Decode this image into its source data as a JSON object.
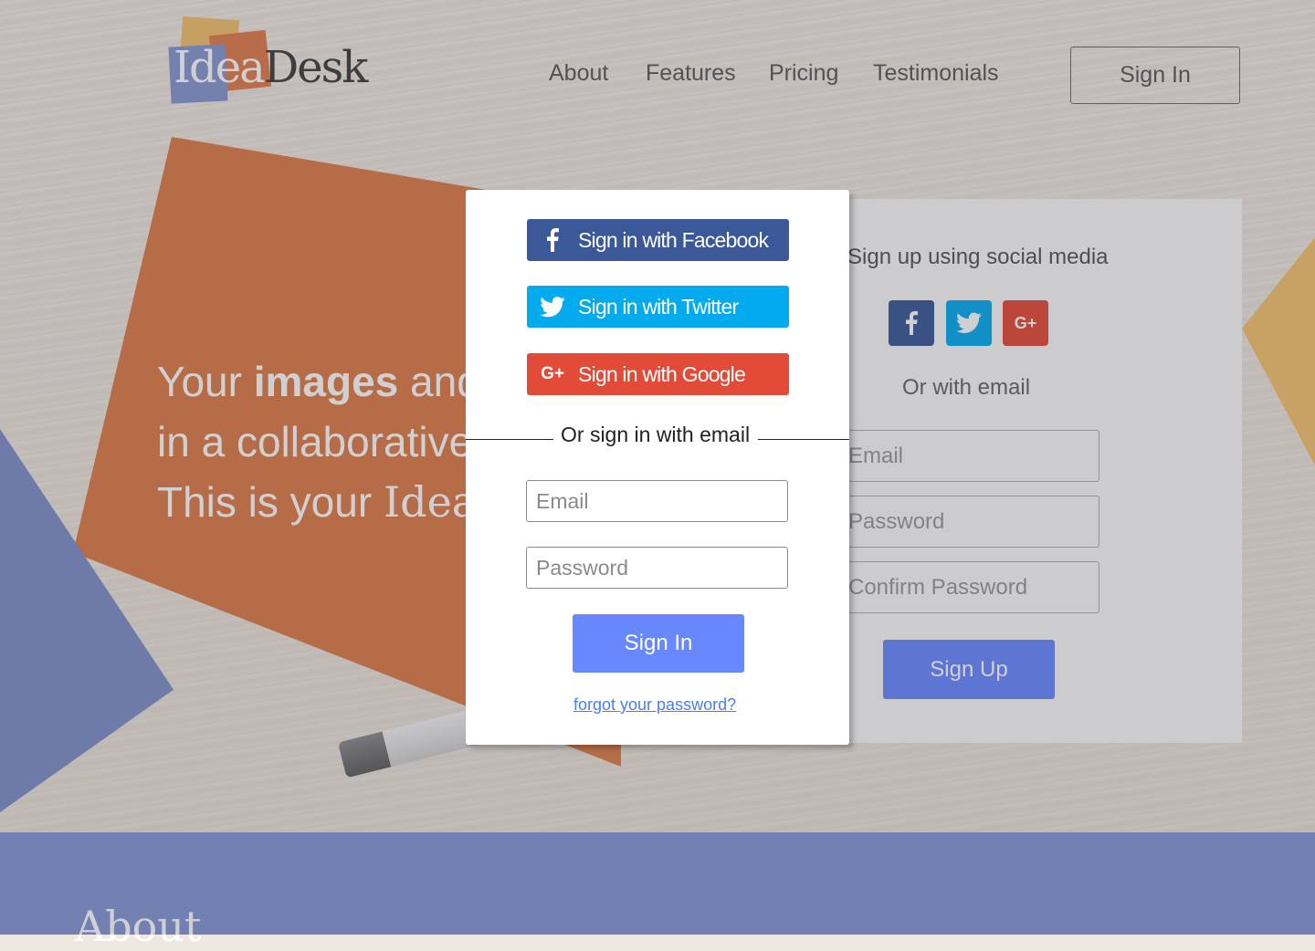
{
  "header": {
    "logo_part1": "Idea",
    "logo_part2": "Desk",
    "nav": [
      {
        "label": "About"
      },
      {
        "label": "Features"
      },
      {
        "label": "Pricing"
      },
      {
        "label": "Testimonials"
      }
    ],
    "signin_label": "Sign In"
  },
  "hero": {
    "line1_a": "Your ",
    "line1_b": "images",
    "line1_c": " and",
    "line2": "in a collaborative",
    "line3_a": "This is your ",
    "line3_b": "Idea"
  },
  "signup": {
    "title": "Sign up using social media",
    "or_email": "Or with email",
    "email_placeholder": "Email",
    "password_placeholder": "Password",
    "confirm_placeholder": "Confirm Password",
    "button": "Sign Up"
  },
  "about": {
    "title": "About"
  },
  "modal": {
    "facebook_label": "Sign in with Facebook",
    "twitter_label": "Sign in with Twitter",
    "google_label": "Sign in with Google",
    "divider": "Or sign in with email",
    "email_placeholder": "Email",
    "password_placeholder": "Password",
    "signin_button": "Sign In",
    "forgot_link": "forgot your password?"
  },
  "colors": {
    "facebook": "#3b5998",
    "twitter": "#03abee",
    "google": "#e24b37",
    "primary": "#6888ff",
    "about_band": "#8596d4",
    "orange": "#dd7d48"
  }
}
